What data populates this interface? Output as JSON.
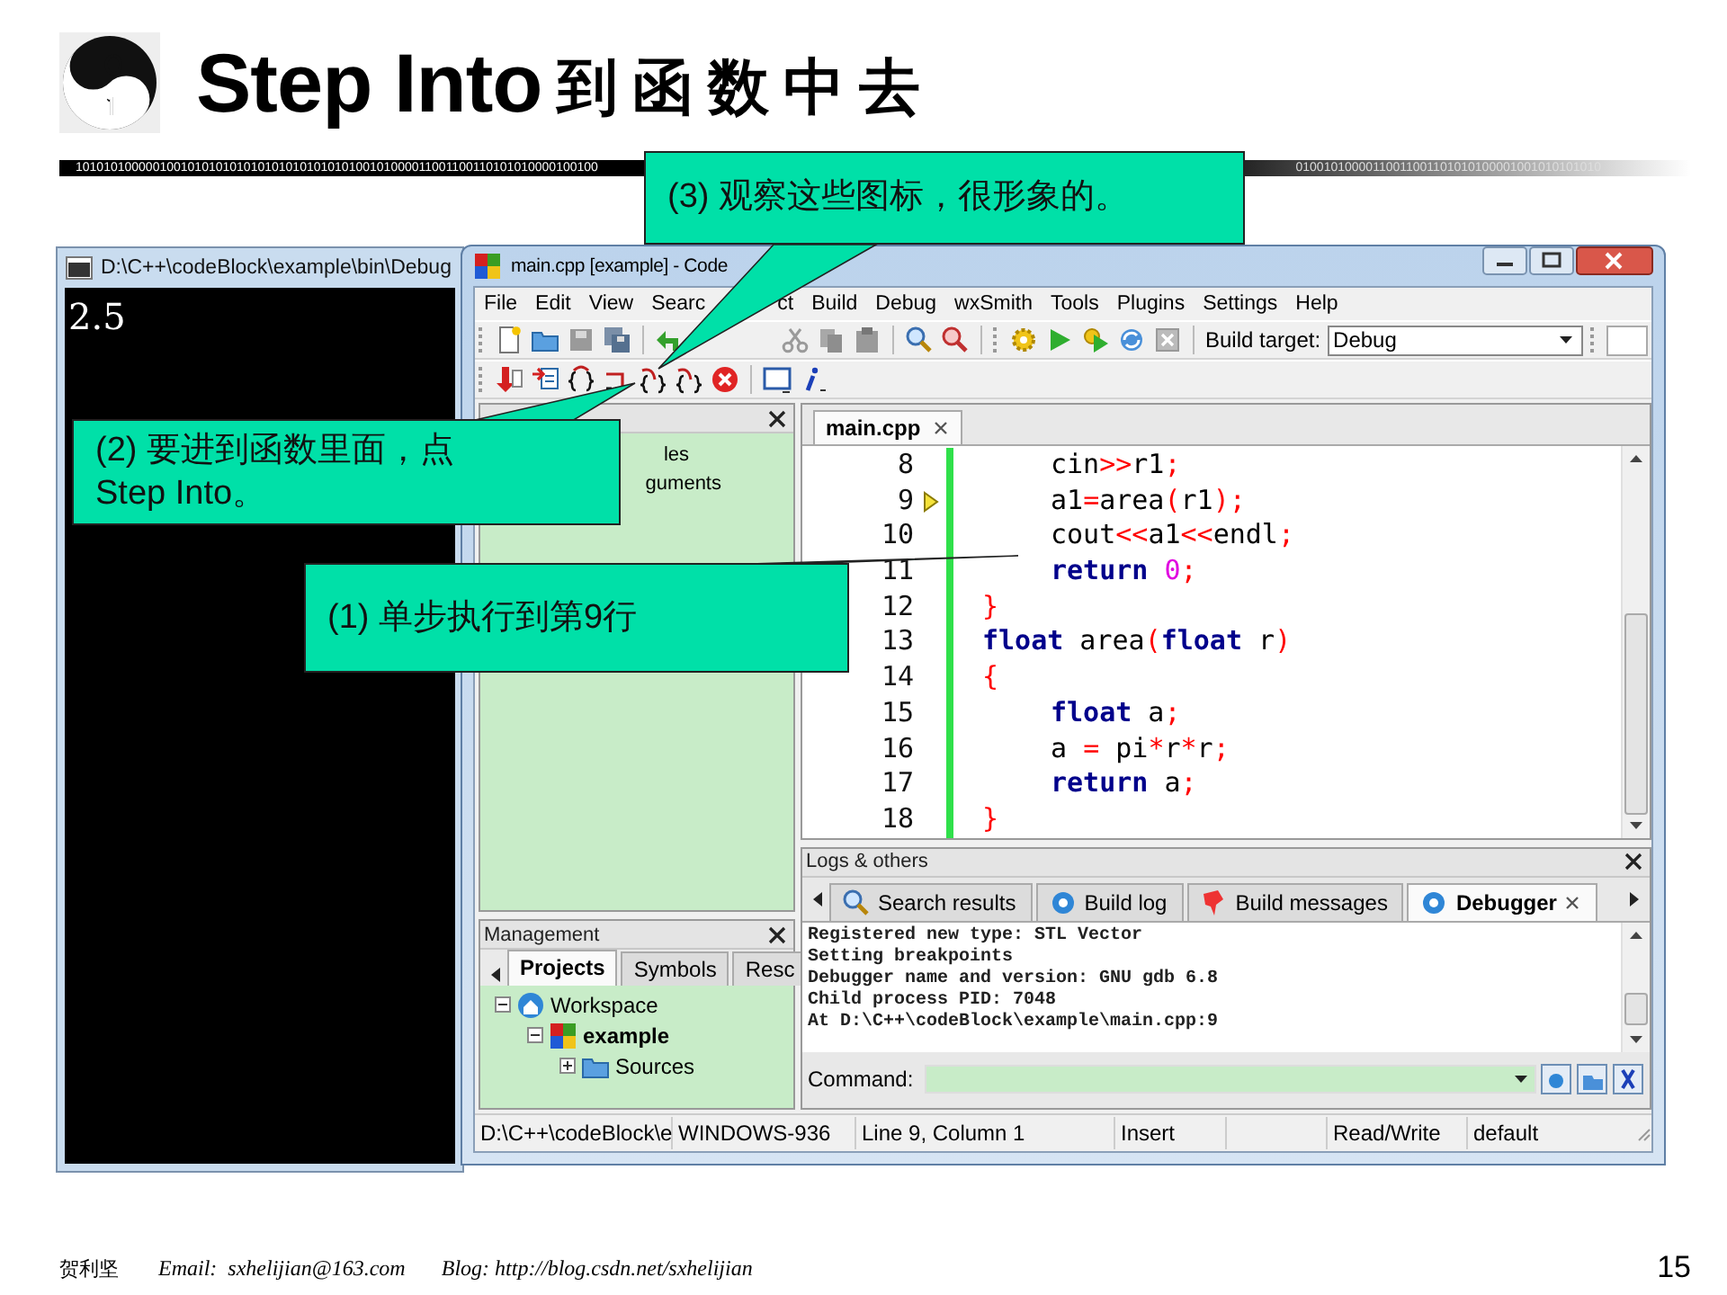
{
  "slide": {
    "title": "Step Into",
    "title_cjk": "到函数中去",
    "binary_strip": [
      "101010100000100101010101010101010101010100101000011001100110101010000100100",
      "01001010000110011001101010100001001010101010"
    ],
    "footer": {
      "author": "贺利坚",
      "email": "Email:  sxhelijian@163.com",
      "blog": "Blog: http://blog.csdn.net/sxhelijian"
    },
    "page_number": "15"
  },
  "console_window": {
    "title": "D:\\C++\\codeBlock\\example\\bin\\Debug",
    "output": "2.5"
  },
  "ide_window": {
    "title": "main.cpp [example] - Code",
    "menu": [
      "File",
      "Edit",
      "View",
      "Searc",
      "ct",
      "Build",
      "Debug",
      "wxSmith",
      "Tools",
      "Plugins",
      "Settings",
      "Help"
    ],
    "toolbar": {
      "build_target_label": "Build target:",
      "build_target": "Debug"
    },
    "left_panel": {
      "items": [
        "les",
        "guments"
      ]
    },
    "editor": {
      "tab": "main.cpp",
      "lines": [
        {
          "number": "8",
          "current": false,
          "indented": true,
          "tokens": [
            {
              "text": "cin",
              "kind": "plain"
            },
            {
              "text": ">>",
              "kind": "op"
            },
            {
              "text": "r1",
              "kind": "plain"
            },
            {
              "text": ";",
              "kind": "op"
            }
          ]
        },
        {
          "number": "9",
          "current": true,
          "indented": true,
          "tokens": [
            {
              "text": "a1",
              "kind": "plain"
            },
            {
              "text": "=",
              "kind": "op"
            },
            {
              "text": "area",
              "kind": "plain"
            },
            {
              "text": "(",
              "kind": "op"
            },
            {
              "text": "r1",
              "kind": "plain"
            },
            {
              "text": ");",
              "kind": "op"
            }
          ]
        },
        {
          "number": "10",
          "current": false,
          "indented": true,
          "tokens": [
            {
              "text": "cout",
              "kind": "plain"
            },
            {
              "text": "<<",
              "kind": "op"
            },
            {
              "text": "a1",
              "kind": "plain"
            },
            {
              "text": "<<",
              "kind": "op"
            },
            {
              "text": "endl",
              "kind": "plain"
            },
            {
              "text": ";",
              "kind": "op"
            }
          ]
        },
        {
          "number": "11",
          "current": false,
          "indented": true,
          "tokens": [
            {
              "text": "return",
              "kind": "kw"
            },
            {
              "text": " 0",
              "kind": "num"
            },
            {
              "text": ";",
              "kind": "op"
            }
          ]
        },
        {
          "number": "12",
          "current": false,
          "indented": false,
          "tokens": [
            {
              "text": "}",
              "kind": "op"
            }
          ]
        },
        {
          "number": "13",
          "current": false,
          "indented": false,
          "tokens": [
            {
              "text": "float",
              "kind": "kw"
            },
            {
              "text": " area",
              "kind": "plain"
            },
            {
              "text": "(",
              "kind": "op"
            },
            {
              "text": "float",
              "kind": "kw"
            },
            {
              "text": " r",
              "kind": "plain"
            },
            {
              "text": ")",
              "kind": "op"
            }
          ]
        },
        {
          "number": "14",
          "current": false,
          "indented": false,
          "tokens": [
            {
              "text": "{",
              "kind": "op"
            }
          ]
        },
        {
          "number": "15",
          "current": false,
          "indented": true,
          "tokens": [
            {
              "text": "float",
              "kind": "kw"
            },
            {
              "text": " a",
              "kind": "plain"
            },
            {
              "text": ";",
              "kind": "op"
            }
          ]
        },
        {
          "number": "16",
          "current": false,
          "indented": true,
          "tokens": [
            {
              "text": "a ",
              "kind": "plain"
            },
            {
              "text": "=",
              "kind": "op"
            },
            {
              "text": " pi",
              "kind": "plain"
            },
            {
              "text": "*",
              "kind": "op"
            },
            {
              "text": "r",
              "kind": "plain"
            },
            {
              "text": "*",
              "kind": "op"
            },
            {
              "text": "r",
              "kind": "plain"
            },
            {
              "text": ";",
              "kind": "op"
            }
          ]
        },
        {
          "number": "17",
          "current": false,
          "indented": true,
          "tokens": [
            {
              "text": "return",
              "kind": "kw"
            },
            {
              "text": " a",
              "kind": "plain"
            },
            {
              "text": ";",
              "kind": "op"
            }
          ]
        },
        {
          "number": "18",
          "current": false,
          "indented": false,
          "tokens": [
            {
              "text": "}",
              "kind": "op"
            }
          ]
        }
      ]
    },
    "logs": {
      "title": "Logs & others",
      "tabs": [
        {
          "label": "Search results",
          "kind": "search",
          "selected": false
        },
        {
          "label": "Build log",
          "kind": "log",
          "selected": false
        },
        {
          "label": "Build messages",
          "kind": "pin",
          "selected": false
        },
        {
          "label": "Debugger",
          "kind": "debugger",
          "selected": true
        }
      ],
      "lines": [
        "Registered new type: STL Vector",
        "Setting breakpoints",
        "Debugger name and version: GNU gdb 6.8",
        "Child process PID: 7048",
        "At D:\\C++\\codeBlock\\example\\main.cpp:9"
      ],
      "command_label": "Command:"
    },
    "management": {
      "title": "Management",
      "tabs": [
        {
          "label": "Projects",
          "selected": true
        },
        {
          "label": "Symbols",
          "selected": false
        },
        {
          "label": "Resc",
          "selected": false
        }
      ],
      "tree": [
        {
          "label": "Workspace",
          "kind": "workspace",
          "expanded": true,
          "active": false,
          "children": [
            {
              "label": "example",
              "kind": "project",
              "expanded": true,
              "active": true,
              "children": [
                {
                  "label": "Sources",
                  "kind": "folder",
                  "expanded": false,
                  "active": false
                }
              ]
            }
          ]
        }
      ]
    },
    "status_bar": [
      "D:\\C++\\codeBlock\\e",
      "WINDOWS-936",
      "Line 9, Column 1",
      "Insert",
      "Read/Write",
      "default"
    ]
  },
  "callouts": [
    {
      "text": "(3) 观察这些图标，很形象的。",
      "kind": "top"
    },
    {
      "text": "(2) 要进到函数里面，点\nStep Into。",
      "kind": "left"
    },
    {
      "text": "(1) 单步执行到第9行",
      "kind": "middle"
    }
  ]
}
